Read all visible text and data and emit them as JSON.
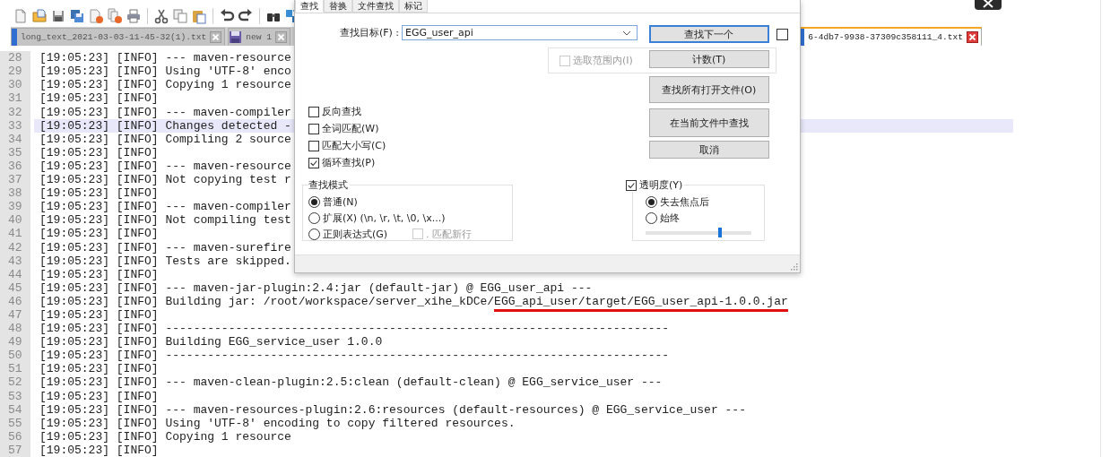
{
  "file_tabs": [
    {
      "label": "long_text_2021-03-03-11-45-32(1).txt",
      "kind": "file",
      "selected": false
    },
    {
      "label": "new 1",
      "kind": "unsaved",
      "selected": false
    },
    {
      "label": "6-4db7-9938-37309c358111_4.txt",
      "kind": "file",
      "selected": true
    }
  ],
  "editor": {
    "lines": [
      {
        "number": "28",
        "time": "[19:05:23]",
        "level": "[INFO]",
        "message": "--- maven-resource",
        "current": false
      },
      {
        "number": "29",
        "time": "[19:05:23]",
        "level": "[INFO]",
        "message": "Using 'UTF-8' enco",
        "current": false
      },
      {
        "number": "30",
        "time": "[19:05:23]",
        "level": "[INFO]",
        "message": "Copying 1 resource",
        "current": false
      },
      {
        "number": "31",
        "time": "[19:05:23]",
        "level": "[INFO]",
        "current": false
      },
      {
        "number": "32",
        "time": "[19:05:23]",
        "level": "[INFO]",
        "message": "--- maven-compiler",
        "current": false
      },
      {
        "number": "33",
        "time": "[19:05:23]",
        "level": "[INFO]",
        "message": "Changes detected -",
        "current": true
      },
      {
        "number": "34",
        "time": "[19:05:23]",
        "level": "[INFO]",
        "message": "Compiling 2 source",
        "current": false
      },
      {
        "number": "35",
        "time": "[19:05:23]",
        "level": "[INFO]",
        "current": false
      },
      {
        "number": "36",
        "time": "[19:05:23]",
        "level": "[INFO]",
        "message": "--- maven-resource",
        "current": false
      },
      {
        "number": "37",
        "time": "[19:05:23]",
        "level": "[INFO]",
        "message": "Not copying test r",
        "current": false
      },
      {
        "number": "38",
        "time": "[19:05:23]",
        "level": "[INFO]",
        "current": false
      },
      {
        "number": "39",
        "time": "[19:05:23]",
        "level": "[INFO]",
        "message": "--- maven-compiler",
        "current": false
      },
      {
        "number": "40",
        "time": "[19:05:23]",
        "level": "[INFO]",
        "message": "Not compiling test",
        "current": false
      },
      {
        "number": "41",
        "time": "[19:05:23]",
        "level": "[INFO]",
        "current": false
      },
      {
        "number": "42",
        "time": "[19:05:23]",
        "level": "[INFO]",
        "message": "--- maven-surefire",
        "current": false
      },
      {
        "number": "43",
        "time": "[19:05:23]",
        "level": "[INFO]",
        "message": "Tests are skipped.",
        "current": false
      },
      {
        "number": "44",
        "time": "[19:05:23]",
        "level": "[INFO]",
        "current": false
      },
      {
        "number": "45",
        "time": "[19:05:23]",
        "level": "[INFO]",
        "message": "--- maven-jar-plugin:2.4:jar (default-jar) @ EGG_user_api ---",
        "current": false
      },
      {
        "number": "46",
        "time": "[19:05:23]",
        "level": "[INFO]",
        "message": "Building jar: /root/workspace/server_xihe_kDCe/",
        "underlined": "EGG_api_user/target/EGG_user_api-1.0.0.jar",
        "current": false
      },
      {
        "number": "47",
        "time": "[19:05:23]",
        "level": "[INFO]",
        "current": false
      },
      {
        "number": "48",
        "time": "[19:05:23]",
        "level": "[INFO]",
        "message": "------------------------------------------------------------------------",
        "current": false
      },
      {
        "number": "49",
        "time": "[19:05:23]",
        "level": "[INFO]",
        "message": "Building EGG_service_user 1.0.0",
        "current": false
      },
      {
        "number": "50",
        "time": "[19:05:23]",
        "level": "[INFO]",
        "message": "------------------------------------------------------------------------",
        "current": false
      },
      {
        "number": "51",
        "time": "[19:05:23]",
        "level": "[INFO]",
        "current": false
      },
      {
        "number": "52",
        "time": "[19:05:23]",
        "level": "[INFO]",
        "message": "--- maven-clean-plugin:2.5:clean (default-clean) @ EGG_service_user ---",
        "current": false
      },
      {
        "number": "53",
        "time": "[19:05:23]",
        "level": "[INFO]",
        "current": false
      },
      {
        "number": "54",
        "time": "[19:05:23]",
        "level": "[INFO]",
        "message": "--- maven-resources-plugin:2.6:resources (default-resources) @ EGG_service_user ---",
        "current": false
      },
      {
        "number": "55",
        "time": "[19:05:23]",
        "level": "[INFO]",
        "message": "Using 'UTF-8' encoding to copy filtered resources.",
        "current": false
      },
      {
        "number": "56",
        "time": "[19:05:23]",
        "level": "[INFO]",
        "message": "Copying 1 resource",
        "current": false
      },
      {
        "number": "57",
        "time": "[19:05:23]",
        "level": "[INFO]",
        "current": false
      }
    ]
  },
  "find_dialog": {
    "tabs": [
      {
        "label": "查找",
        "selected": true
      },
      {
        "label": "替换",
        "selected": false
      },
      {
        "label": "文件查找",
        "selected": false
      },
      {
        "label": "标记",
        "selected": false
      }
    ],
    "find_label": "查找目标(F) :",
    "find_value": "EGG_user_api",
    "buttons": [
      {
        "label": "查找下一个",
        "selected": true
      },
      {
        "label": "计数(T)",
        "selected": false
      },
      {
        "label": "查找所有打开文件(O)",
        "selected": false
      },
      {
        "label": "在当前文件中查找",
        "selected": false
      },
      {
        "label": "取消",
        "selected": false
      }
    ],
    "side_checkbox": {
      "checked": false
    },
    "in_selection": {
      "label": "选取范围内(I)",
      "checked": false,
      "disabled": true
    },
    "options": [
      {
        "label": "反向查找",
        "checked": false
      },
      {
        "label": "全词匹配(W)",
        "checked": false
      },
      {
        "label": "匹配大小写(C)",
        "checked": false
      },
      {
        "label": "循环查找(P)",
        "checked": true
      }
    ],
    "search_mode": {
      "title": "查找模式",
      "modes": [
        {
          "label": "普通(N)",
          "selected": true
        },
        {
          "label": "扩展(X) (\\n, \\r, \\t, \\0, \\x...)",
          "selected": false
        },
        {
          "label": "正则表达式(G)",
          "selected": false
        }
      ],
      "match_newline": {
        "label": ". 匹配新行",
        "checked": false,
        "disabled": true
      }
    },
    "transparency": {
      "label": "透明度(Y)",
      "checked": true,
      "modes": [
        {
          "label": "失去焦点后",
          "selected": true
        },
        {
          "label": "始终",
          "selected": false
        }
      ],
      "level": 0.7
    }
  }
}
